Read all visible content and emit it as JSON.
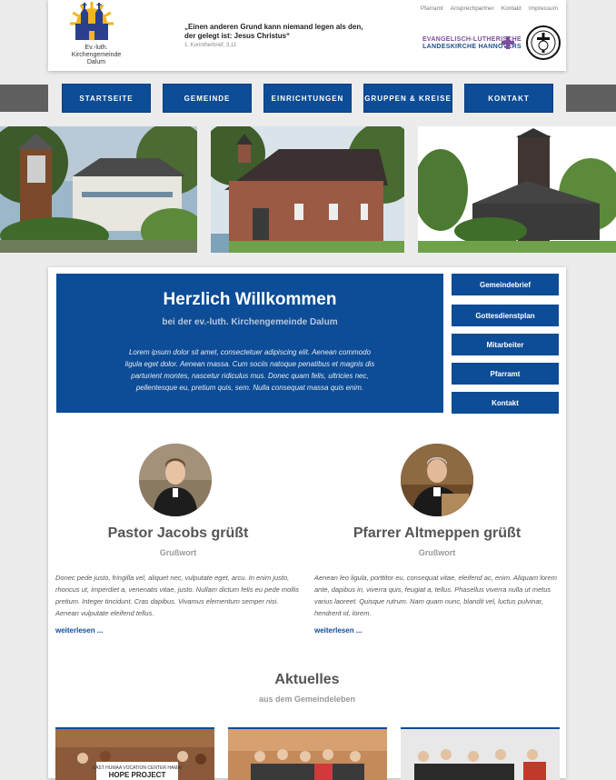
{
  "header": {
    "logo_text": [
      "Ev.-luth.",
      "Kirchengemeinde",
      "Dalum"
    ],
    "quote": "„Einen anderen Grund kann niemand legen als den, der gelegt ist: Jesus Christus“",
    "quote_ref": "1. Korintherbrief, 3,11",
    "top_links": [
      "Pfarramt",
      "Ansprechpartner",
      "Kontakt",
      "Impressum"
    ],
    "church_logo": [
      "EVANGELISCH-LUTHERISCHE",
      "LANDESKIRCHE HANNOVERS"
    ]
  },
  "nav": [
    "STARTSEITE",
    "GEMEINDE",
    "EINRICHTUNGEN",
    "GRUPPEN & KREISE",
    "KONTAKT"
  ],
  "welcome": {
    "title": "Herzlich Willkommen",
    "subtitle": "bei der ev.-luth. Kirchengemeinde Dalum",
    "text": "Lorem ipsum dolor sit amet, consectetuer adipiscing elit. Aenean commodo ligula eget dolor. Aenean massa. Cum sociis natoque penatibus et magnis dis parturient montes, nascetur ridiculus mus. Donec quam felis, ultricies nec, pellentesque eu, pretium quis, sem. Nulla consequat massa quis enim."
  },
  "side_buttons": [
    "Gemeindebrief",
    "Gottesdienstplan",
    "Mitarbeiter",
    "Pfarramt",
    "Kontakt"
  ],
  "greetings": [
    {
      "title": "Pastor Jacobs grüßt",
      "subtitle": "Grußwort",
      "text": "Donec pede justo, fringilla vel, aliquet nec, vulputate eget, arcu. In enim justo, rhoncus ut, imperdiet a, venenatis vitae, justo. Nullam dictum felis eu pede mollis pretium. Integer tincidunt. Cras dapibus. Vivamus elementum semper nisi. Aenean vulputate eleifend tellus.",
      "link": "weiterlesen ..."
    },
    {
      "title": "Pfarrer Altmeppen grüßt",
      "subtitle": "Grußwort",
      "text": "Aenean leo ligula, porttitor eu, consequat vitae, eleifend ac, enim. Aliquam lorem ante, dapibus in, viverra quis, feugiat a, tellus. Phasellus viverra nulla ut metus varius laoreet. Quisque rutrum. Nam quam nunc, blandit vel, luctus pulvinar, hendrerit id, lorem.",
      "link": "weiterlesen ..."
    }
  ],
  "news": {
    "title": "Aktuelles",
    "subtitle": "aus dem Gemeindeleben",
    "banner_text": [
      "EAST HUMAA VOCATION CENTER HAMAI",
      "HOPE PROJECT"
    ]
  },
  "colors": {
    "primary": "#0d4c96",
    "nav_side": "#5f5f5f",
    "background": "#ececec"
  }
}
